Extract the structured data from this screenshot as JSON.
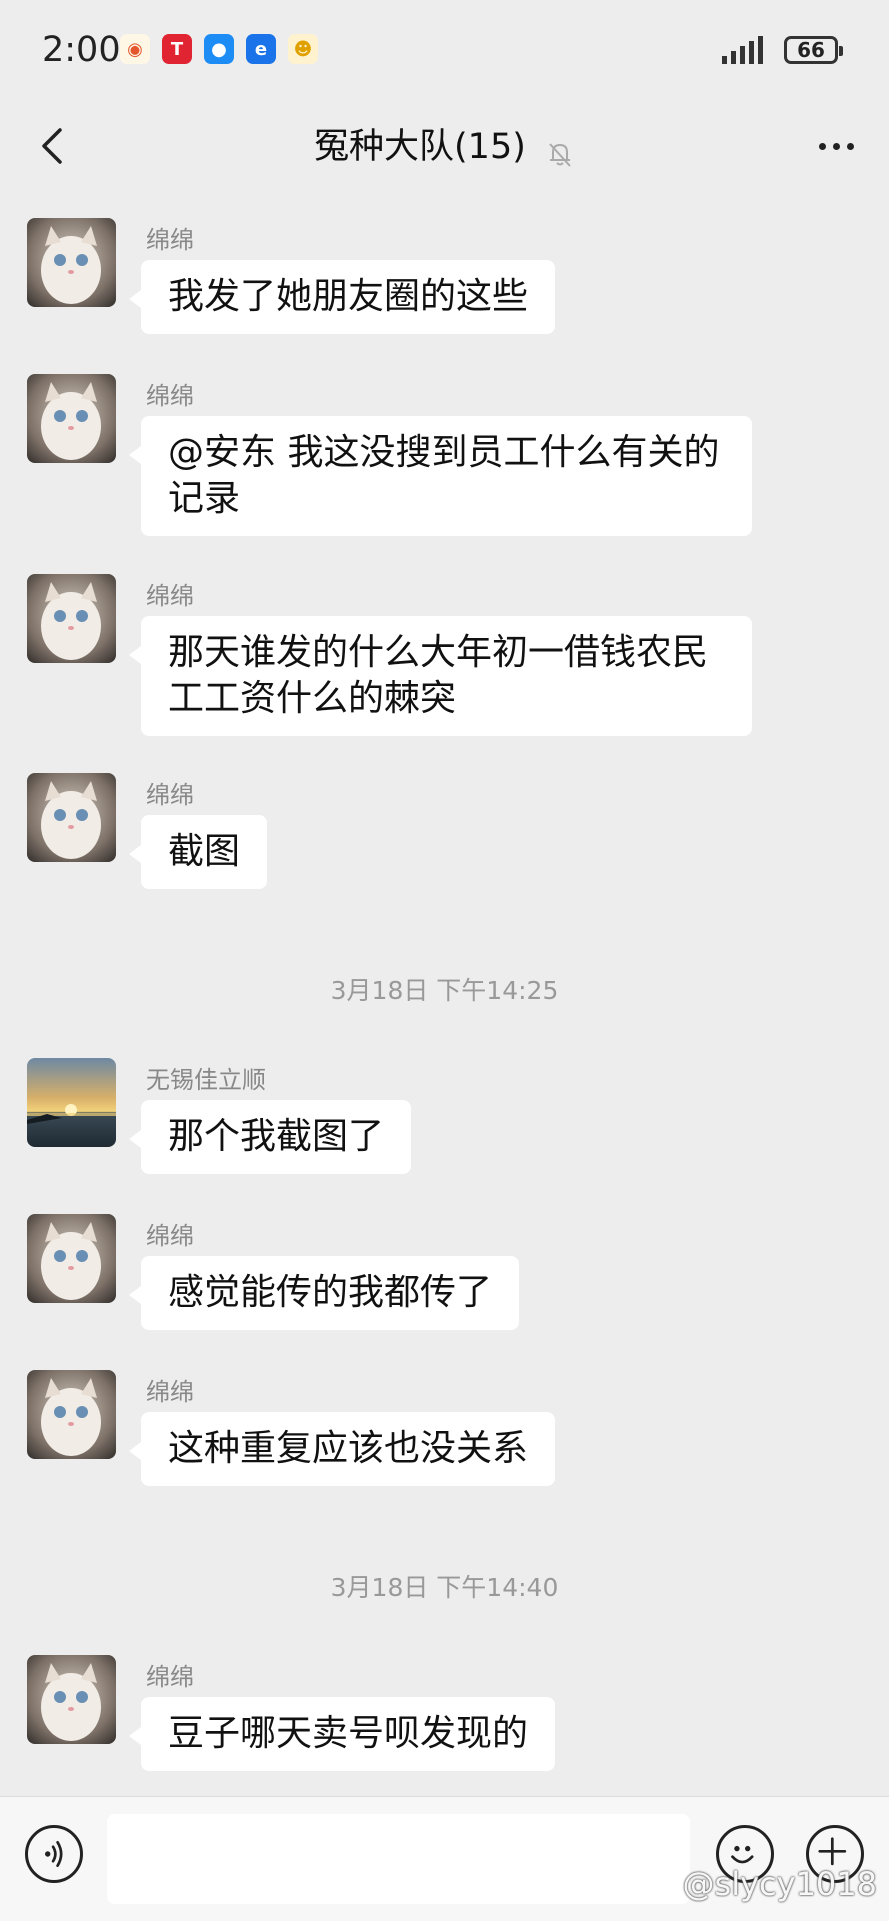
{
  "status_bar": {
    "time": "2:00",
    "battery": "66",
    "app_icons": [
      {
        "name": "weibo-icon",
        "color": "#f5a623",
        "glyph": "◉"
      },
      {
        "name": "tesla-icon",
        "color": "#e02431",
        "glyph": "T"
      },
      {
        "name": "message-icon",
        "color": "#1e8cf5",
        "glyph": "●"
      },
      {
        "name": "browser-icon",
        "color": "#1a73e8",
        "glyph": "e"
      },
      {
        "name": "mascot-icon",
        "color": "#f3c33c",
        "glyph": "☻"
      }
    ]
  },
  "header": {
    "title": "冤种大队(15)"
  },
  "messages": [
    {
      "sender": "绵绵",
      "text": "我发了她朋友圈的这些",
      "avatar": "cat"
    },
    {
      "sender": "绵绵",
      "text": "@安东  我这没搜到员工什么有关的记录",
      "avatar": "cat"
    },
    {
      "sender": "绵绵",
      "text": "那天谁发的什么大年初一借钱农民工工资什么的棘突",
      "avatar": "cat"
    },
    {
      "sender": "绵绵",
      "text": "截图",
      "avatar": "cat"
    },
    {
      "sender": "无锡佳立顺",
      "text": "那个我截图了",
      "avatar": "sunset"
    },
    {
      "sender": "绵绵",
      "text": "感觉能传的我都传了",
      "avatar": "cat"
    },
    {
      "sender": "绵绵",
      "text": "这种重复应该也没关系",
      "avatar": "cat"
    },
    {
      "sender": "绵绵",
      "text": "豆子哪天卖号呗发现的",
      "avatar": "cat"
    }
  ],
  "timestamps": [
    "3月18日 下午14:25",
    "3月18日 下午14:40"
  ],
  "watermark": "@slycy1018",
  "colors": {
    "background": "#ededed",
    "bubble": "#ffffff",
    "sender": "#888888",
    "timestamp": "#999999"
  }
}
